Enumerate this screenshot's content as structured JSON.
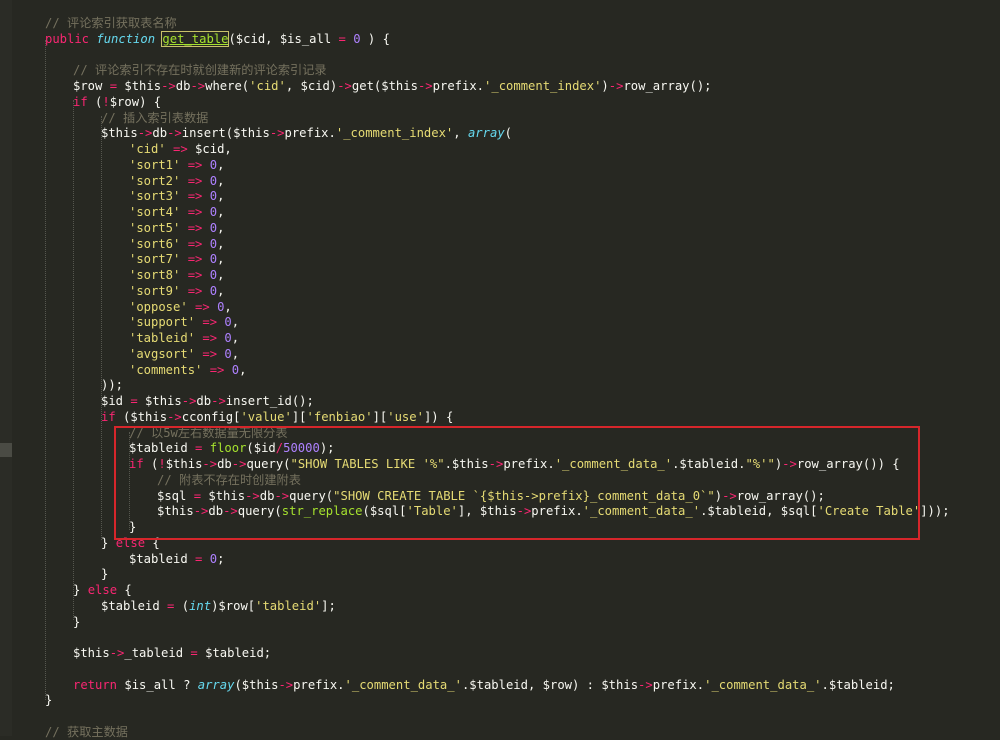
{
  "editor": {
    "theme": "monokai",
    "colors": {
      "background": "#272822",
      "comment": "#75715e",
      "keyword": "#f92672",
      "string": "#e6db74",
      "number": "#ae81ff",
      "function_name": "#a6e22e",
      "highlight_box": "#d6262b"
    },
    "lines": [
      [
        [
          "cm",
          "// 评论索引获取表名称"
        ]
      ],
      [
        [
          "kw",
          "public"
        ],
        [
          "",
          "&nbsp;"
        ],
        [
          "ty",
          "function"
        ],
        [
          "",
          "&nbsp;"
        ],
        [
          "fnhl",
          "get_table"
        ],
        [
          "",
          "($cid, $is_all "
        ],
        [
          "kw",
          "="
        ],
        [
          "",
          ""
        ],
        [
          "nm",
          " 0"
        ],
        [
          "",
          " ) {"
        ]
      ],
      [
        [
          "",
          ""
        ]
      ],
      [
        [
          "cm",
          "// 评论索引不存在时就创建新的评论索引记录"
        ]
      ],
      [
        [
          "",
          "$row "
        ],
        [
          "kw",
          "="
        ],
        [
          "",
          " $this"
        ],
        [
          "ar",
          "->"
        ],
        [
          "",
          "db"
        ],
        [
          "ar",
          "->"
        ],
        [
          "",
          "where("
        ],
        [
          "st",
          "'cid'"
        ],
        [
          "",
          ", $cid)"
        ],
        [
          "ar",
          "->"
        ],
        [
          "",
          "get($this"
        ],
        [
          "ar",
          "->"
        ],
        [
          "",
          "prefix."
        ],
        [
          "st",
          "'_comment_index'"
        ],
        [
          "",
          ")"
        ],
        [
          "ar",
          "->"
        ],
        [
          "",
          "row_array();"
        ]
      ],
      [
        [
          "kw",
          "if"
        ],
        [
          "",
          " ("
        ],
        [
          "kw",
          "!"
        ],
        [
          "",
          "$row) {"
        ]
      ],
      [
        [
          "cm",
          "// 插入索引表数据"
        ]
      ],
      [
        [
          "",
          "$this"
        ],
        [
          "ar",
          "->"
        ],
        [
          "",
          "db"
        ],
        [
          "ar",
          "->"
        ],
        [
          "",
          "insert($this"
        ],
        [
          "ar",
          "->"
        ],
        [
          "",
          "prefix."
        ],
        [
          "st",
          "'_comment_index'"
        ],
        [
          "",
          ", "
        ],
        [
          "ty",
          "array"
        ],
        [
          "",
          "("
        ]
      ],
      [
        [
          "st",
          "'cid'"
        ],
        [
          "",
          " "
        ],
        [
          "kw",
          "=>"
        ],
        [
          "",
          " $cid,"
        ]
      ],
      [
        [
          "st",
          "'sort1'"
        ],
        [
          "",
          " "
        ],
        [
          "kw",
          "=>"
        ],
        [
          "",
          " "
        ],
        [
          "nm",
          "0"
        ],
        [
          "",
          ","
        ]
      ],
      [
        [
          "st",
          "'sort2'"
        ],
        [
          "",
          " "
        ],
        [
          "kw",
          "=>"
        ],
        [
          "",
          " "
        ],
        [
          "nm",
          "0"
        ],
        [
          "",
          ","
        ]
      ],
      [
        [
          "st",
          "'sort3'"
        ],
        [
          "",
          " "
        ],
        [
          "kw",
          "=>"
        ],
        [
          "",
          " "
        ],
        [
          "nm",
          "0"
        ],
        [
          "",
          ","
        ]
      ],
      [
        [
          "st",
          "'sort4'"
        ],
        [
          "",
          " "
        ],
        [
          "kw",
          "=>"
        ],
        [
          "",
          " "
        ],
        [
          "nm",
          "0"
        ],
        [
          "",
          ","
        ]
      ],
      [
        [
          "st",
          "'sort5'"
        ],
        [
          "",
          " "
        ],
        [
          "kw",
          "=>"
        ],
        [
          "",
          " "
        ],
        [
          "nm",
          "0"
        ],
        [
          "",
          ","
        ]
      ],
      [
        [
          "st",
          "'sort6'"
        ],
        [
          "",
          " "
        ],
        [
          "kw",
          "=>"
        ],
        [
          "",
          " "
        ],
        [
          "nm",
          "0"
        ],
        [
          "",
          ","
        ]
      ],
      [
        [
          "st",
          "'sort7'"
        ],
        [
          "",
          " "
        ],
        [
          "kw",
          "=>"
        ],
        [
          "",
          " "
        ],
        [
          "nm",
          "0"
        ],
        [
          "",
          ","
        ]
      ],
      [
        [
          "st",
          "'sort8'"
        ],
        [
          "",
          " "
        ],
        [
          "kw",
          "=>"
        ],
        [
          "",
          " "
        ],
        [
          "nm",
          "0"
        ],
        [
          "",
          ","
        ]
      ],
      [
        [
          "st",
          "'sort9'"
        ],
        [
          "",
          " "
        ],
        [
          "kw",
          "=>"
        ],
        [
          "",
          " "
        ],
        [
          "nm",
          "0"
        ],
        [
          "",
          ","
        ]
      ],
      [
        [
          "st",
          "'oppose'"
        ],
        [
          "",
          " "
        ],
        [
          "kw",
          "=>"
        ],
        [
          "",
          " "
        ],
        [
          "nm",
          "0"
        ],
        [
          "",
          ","
        ]
      ],
      [
        [
          "st",
          "'support'"
        ],
        [
          "",
          " "
        ],
        [
          "kw",
          "=>"
        ],
        [
          "",
          " "
        ],
        [
          "nm",
          "0"
        ],
        [
          "",
          ","
        ]
      ],
      [
        [
          "st",
          "'tableid'"
        ],
        [
          "",
          " "
        ],
        [
          "kw",
          "=>"
        ],
        [
          "",
          " "
        ],
        [
          "nm",
          "0"
        ],
        [
          "",
          ","
        ]
      ],
      [
        [
          "st",
          "'avgsort'"
        ],
        [
          "",
          " "
        ],
        [
          "kw",
          "=>"
        ],
        [
          "",
          " "
        ],
        [
          "nm",
          "0"
        ],
        [
          "",
          ","
        ]
      ],
      [
        [
          "st",
          "'comments'"
        ],
        [
          "",
          " "
        ],
        [
          "kw",
          "=>"
        ],
        [
          "",
          " "
        ],
        [
          "nm",
          "0"
        ],
        [
          "",
          ","
        ]
      ],
      [
        [
          "",
          "));"
        ]
      ],
      [
        [
          "",
          "$id "
        ],
        [
          "kw",
          "="
        ],
        [
          "",
          " $this"
        ],
        [
          "ar",
          "->"
        ],
        [
          "",
          "db"
        ],
        [
          "ar",
          "->"
        ],
        [
          "",
          "insert_id();"
        ]
      ],
      [
        [
          "kw",
          "if"
        ],
        [
          "",
          " ($this"
        ],
        [
          "ar",
          "->"
        ],
        [
          "",
          "cconfig["
        ],
        [
          "st",
          "'value'"
        ],
        [
          "",
          "]["
        ],
        [
          "st",
          "'fenbiao'"
        ],
        [
          "",
          "]["
        ],
        [
          "st",
          "'use'"
        ],
        [
          "",
          "]) {"
        ]
      ],
      [
        [
          "cm",
          "// 以5w左右数据量无限分表"
        ]
      ],
      [
        [
          "",
          "$tableid "
        ],
        [
          "kw",
          "="
        ],
        [
          "",
          " "
        ],
        [
          "fn",
          "floor"
        ],
        [
          "",
          "($id"
        ],
        [
          "kw",
          "/"
        ],
        [
          "nm",
          "50000"
        ],
        [
          "",
          ");"
        ]
      ],
      [
        [
          "kw",
          "if"
        ],
        [
          "",
          " ("
        ],
        [
          "kw",
          "!"
        ],
        [
          "",
          "$this"
        ],
        [
          "ar",
          "->"
        ],
        [
          "",
          "db"
        ],
        [
          "ar",
          "->"
        ],
        [
          "",
          "query("
        ],
        [
          "st",
          "\"SHOW TABLES LIKE '%\""
        ],
        [
          "",
          ".$this"
        ],
        [
          "ar",
          "->"
        ],
        [
          "",
          "prefix."
        ],
        [
          "st",
          "'_comment_data_'"
        ],
        [
          "",
          ".$tableid."
        ],
        [
          "st",
          "\"%'\""
        ],
        [
          "",
          ")"
        ],
        [
          "ar",
          "->"
        ],
        [
          "",
          "row_array()) {"
        ]
      ],
      [
        [
          "cm",
          "// 附表不存在时创建附表"
        ]
      ],
      [
        [
          "",
          "$sql "
        ],
        [
          "kw",
          "="
        ],
        [
          "",
          " $this"
        ],
        [
          "ar",
          "->"
        ],
        [
          "",
          "db"
        ],
        [
          "ar",
          "->"
        ],
        [
          "",
          "query("
        ],
        [
          "st",
          "\"SHOW CREATE TABLE `{$this->prefix}_comment_data_0`\""
        ],
        [
          "",
          ")"
        ],
        [
          "ar",
          "->"
        ],
        [
          "",
          "row_array();"
        ]
      ],
      [
        [
          "",
          "$this"
        ],
        [
          "ar",
          "->"
        ],
        [
          "",
          "db"
        ],
        [
          "ar",
          "->"
        ],
        [
          "",
          "query("
        ],
        [
          "fn",
          "str_replace"
        ],
        [
          "",
          "($sql["
        ],
        [
          "st",
          "'Table'"
        ],
        [
          "",
          "], $this"
        ],
        [
          "ar",
          "->"
        ],
        [
          "",
          "prefix."
        ],
        [
          "st",
          "'_comment_data_'"
        ],
        [
          "",
          ".$tableid, $sql["
        ],
        [
          "st",
          "'Create Table'"
        ],
        [
          "",
          "]));"
        ]
      ],
      [
        [
          "",
          "}"
        ]
      ],
      [
        [
          "",
          "} "
        ],
        [
          "kw",
          "else"
        ],
        [
          "",
          " {"
        ]
      ],
      [
        [
          "",
          "$tableid "
        ],
        [
          "kw",
          "="
        ],
        [
          "",
          " "
        ],
        [
          "nm",
          "0"
        ],
        [
          "",
          ";"
        ]
      ],
      [
        [
          "",
          "}"
        ]
      ],
      [
        [
          "",
          "} "
        ],
        [
          "kw",
          "else"
        ],
        [
          "",
          " {"
        ]
      ],
      [
        [
          "",
          "$tableid "
        ],
        [
          "kw",
          "="
        ],
        [
          "",
          " ("
        ],
        [
          "ty",
          "int"
        ],
        [
          "",
          ")$row["
        ],
        [
          "st",
          "'tableid'"
        ],
        [
          "",
          "];"
        ]
      ],
      [
        [
          "",
          "}"
        ]
      ],
      [
        [
          "",
          ""
        ]
      ],
      [
        [
          "",
          "$this"
        ],
        [
          "ar",
          "->"
        ],
        [
          "",
          "_tableid "
        ],
        [
          "kw",
          "="
        ],
        [
          "",
          " $tableid;"
        ]
      ],
      [
        [
          "",
          ""
        ]
      ],
      [
        [
          "kw",
          "return"
        ],
        [
          "",
          " $is_all ? "
        ],
        [
          "ty",
          "array"
        ],
        [
          "",
          "($this"
        ],
        [
          "ar",
          "->"
        ],
        [
          "",
          "prefix."
        ],
        [
          "st",
          "'_comment_data_'"
        ],
        [
          "",
          ".$tableid, $row) : $this"
        ],
        [
          "ar",
          "->"
        ],
        [
          "",
          "prefix."
        ],
        [
          "st",
          "'_comment_data_'"
        ],
        [
          "",
          ".$tableid;"
        ]
      ],
      [
        [
          "",
          "}"
        ]
      ],
      [
        [
          "",
          ""
        ]
      ],
      [
        [
          "cm",
          "// 获取主数据"
        ]
      ]
    ]
  }
}
